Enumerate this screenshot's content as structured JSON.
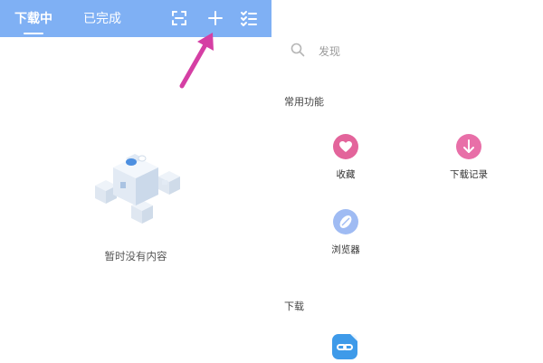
{
  "left_panel": {
    "tabs": [
      {
        "label": "下载中",
        "active": true
      },
      {
        "label": "已完成",
        "active": false
      }
    ],
    "toolbar_icons": [
      "scan-icon",
      "plus-icon",
      "checklist-icon"
    ],
    "empty_state": {
      "text": "暂时没有内容",
      "icon": "empty-box-illustration"
    },
    "colors": {
      "topbar": "#7fb0f4",
      "annotation_arrow": "#d53fa4"
    }
  },
  "right_panel": {
    "search": {
      "placeholder": "发现",
      "icon": "search-icon"
    },
    "sections": {
      "common": {
        "title": "常用功能",
        "items": [
          {
            "label": "收藏",
            "icon": "heart-icon",
            "color": "#e3649b"
          },
          {
            "label": "下载记录",
            "icon": "download-arrow-icon",
            "color": "#e86fa8"
          },
          {
            "label": "浏览器",
            "icon": "compass-icon",
            "color": "#9fbbf3"
          }
        ]
      },
      "download": {
        "title": "下载",
        "items": [
          {
            "icon": "link-file-icon",
            "color": "#3e9ae9"
          }
        ]
      }
    }
  }
}
